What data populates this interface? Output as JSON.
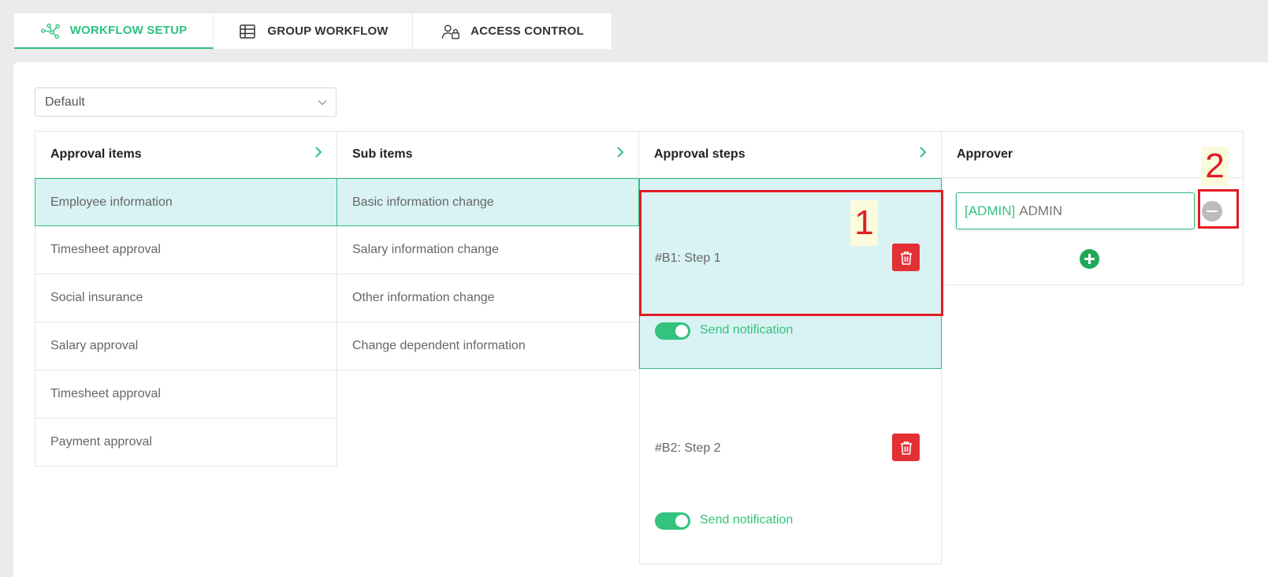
{
  "tabs": [
    {
      "label": "WORKFLOW SETUP",
      "icon": "workflow-nodes-icon",
      "active": true
    },
    {
      "label": "GROUP WORKFLOW",
      "icon": "table-icon",
      "active": false
    },
    {
      "label": "ACCESS CONTROL",
      "icon": "user-lock-icon",
      "active": false
    }
  ],
  "workflow_select": {
    "value": "Default"
  },
  "approval_items": {
    "title": "Approval items",
    "items": [
      "Employee information",
      "Timesheet approval",
      "Social insurance",
      "Salary approval",
      "Timesheet approval",
      "Payment approval"
    ]
  },
  "sub_items": {
    "title": "Sub items",
    "items": [
      "Basic information change",
      "Salary information change",
      "Other information change",
      "Change dependent information"
    ]
  },
  "approval_steps": {
    "title": "Approval steps",
    "steps": [
      {
        "label": "#B1: Step 1",
        "notification": "Send notification"
      },
      {
        "label": "#B2: Step 2",
        "notification": "Send notification"
      }
    ]
  },
  "approver": {
    "title": "Approver",
    "entries": [
      {
        "tag": "[ADMIN]",
        "name": "ADMIN"
      }
    ]
  },
  "annotations": [
    "1",
    "2"
  ],
  "colors": {
    "accent": "#2ec27e",
    "selected_bg": "#d9f2f4",
    "danger": "#e33035",
    "annotation": "#e21b23"
  }
}
